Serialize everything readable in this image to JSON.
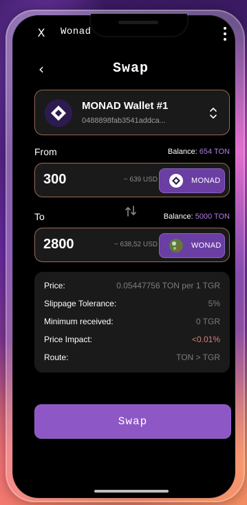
{
  "app": {
    "header": {
      "close_glyph": "X",
      "title": "Wonad"
    },
    "topbar": {
      "back_glyph": "‹",
      "title": "Swap"
    },
    "wallet": {
      "name": "MONAD Wallet #1",
      "address": "0488898fab3541addca...",
      "chevron_glyph": "⌃\n⌄"
    },
    "from": {
      "label": "From",
      "balance_label": "Balance:",
      "balance_value": "654 TON",
      "amount": "300",
      "usd": "~ 639 USD",
      "token": "MONAD"
    },
    "to": {
      "label": "To",
      "balance_label": "Balance:",
      "balance_value": "5000 TON",
      "amount": "2800",
      "usd": "~ 638,52 USD",
      "token": "WONAD"
    },
    "details": [
      {
        "label": "Price:",
        "value": "0.05447756 TON per 1 TGR"
      },
      {
        "label": "Slippage Tolerance:",
        "value": "5%"
      },
      {
        "label": "Minimum received:",
        "value": "0 TGR"
      },
      {
        "label": "Price Impact:",
        "value": "<0.01%"
      },
      {
        "label": "Route:",
        "value": "TON > TGR"
      }
    ],
    "action": {
      "swap_button_label": "Swap"
    },
    "colors": {
      "accent_purple": "#8d58c6",
      "balance_accent": "#b07ce6",
      "impact_color": "#d68074"
    },
    "icons": {
      "close": "close-icon",
      "more": "more-vertical-icon",
      "back": "back-chevron-icon",
      "wallet": "monad-logo-icon",
      "wallet_toggle": "chevron-up-down-icon",
      "swap_direction": "swap-arrows-icon",
      "token_from": "monad-token-icon",
      "token_to": "wonad-token-icon"
    }
  }
}
